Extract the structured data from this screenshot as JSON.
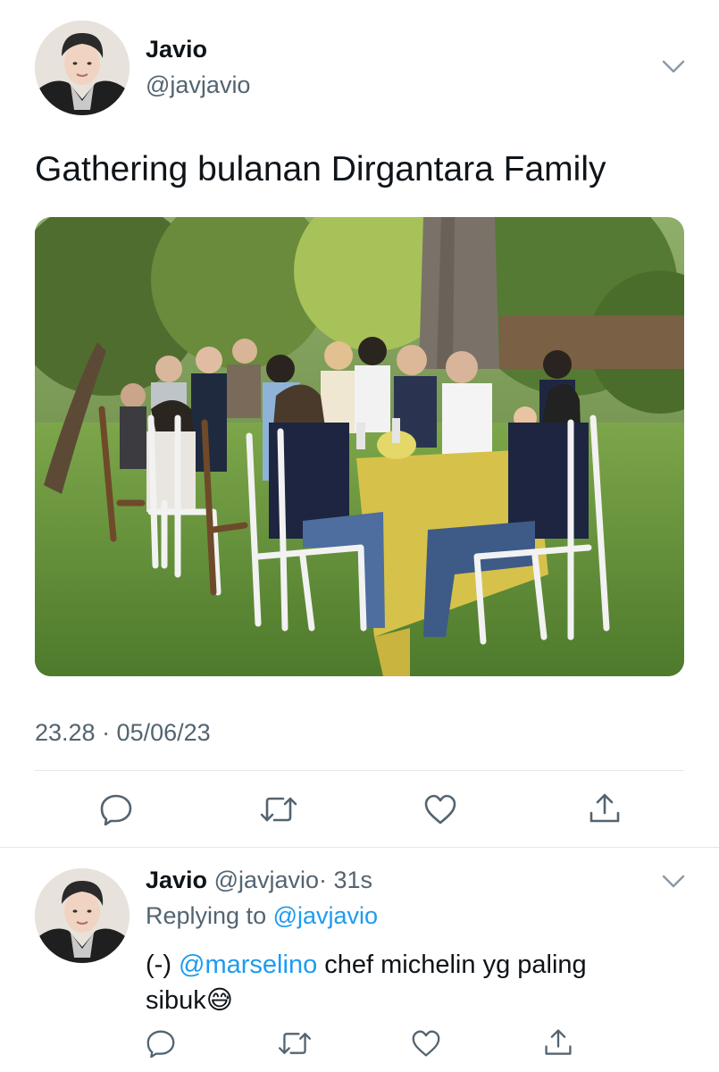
{
  "tweet": {
    "author_name": "Javio",
    "author_handle": "@javjavio",
    "text": "Gathering bulanan Dirgantara Family",
    "timestamp": "23.28 · 05/06/23",
    "actions": [
      "reply-icon",
      "retweet-icon",
      "like-icon",
      "share-icon"
    ]
  },
  "reply": {
    "author_name": "Javio",
    "author_handle": "@javjavio",
    "time": "· 31s",
    "replying_prefix": "Replying to",
    "replying_handle": "@javjavio",
    "text_prefix": "(-)",
    "mention": "@marselino",
    "text_line1": "chef michelin yg paling",
    "text_line2": "sibuk",
    "emoji": "😅"
  },
  "colors": {
    "text": "#0f1419",
    "muted": "#536471",
    "link": "#1d9bf0",
    "divider": "#e6e6e6"
  }
}
